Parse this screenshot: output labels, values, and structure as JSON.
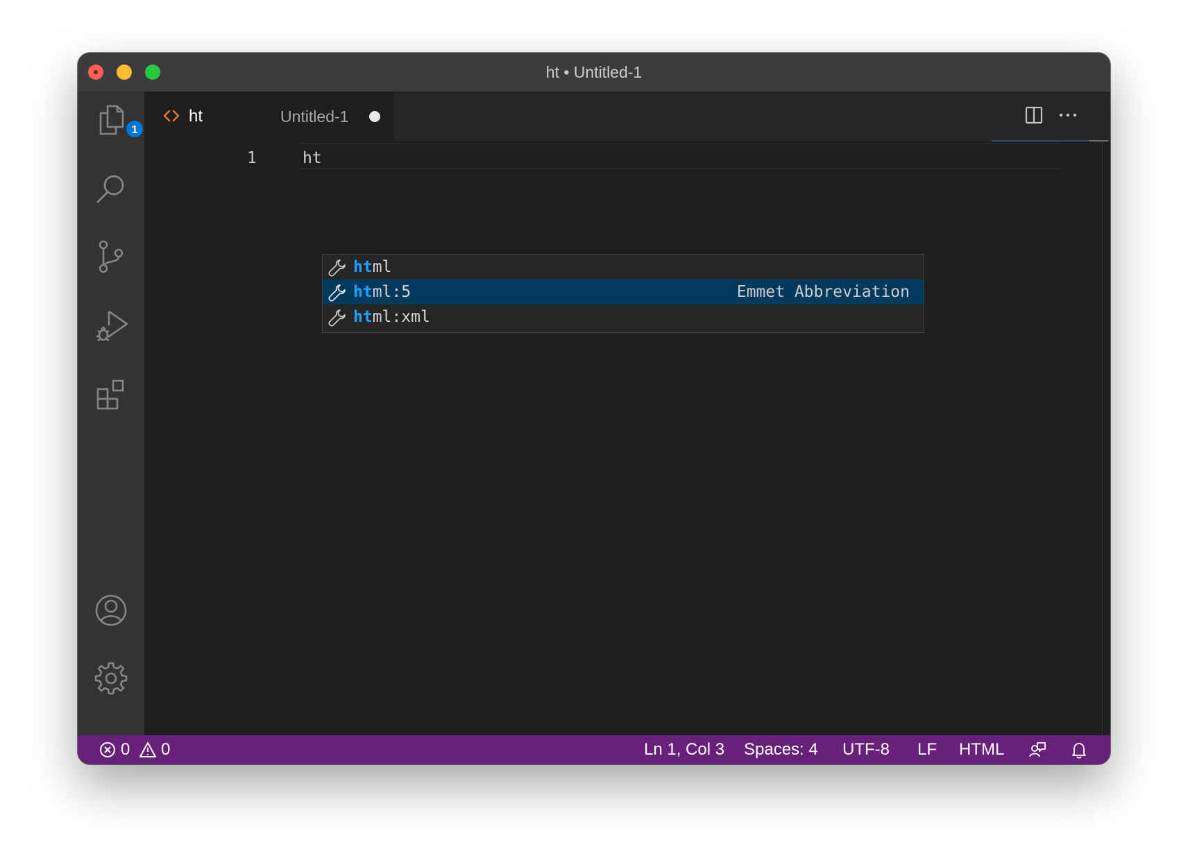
{
  "window": {
    "title": "ht • Untitled-1"
  },
  "activity_bar": {
    "items": [
      {
        "name": "explorer",
        "icon": "files-icon",
        "badge": "1"
      },
      {
        "name": "search",
        "icon": "search-icon"
      },
      {
        "name": "source-control",
        "icon": "source-control-icon"
      },
      {
        "name": "run-and-debug",
        "icon": "run-debug-icon"
      },
      {
        "name": "extensions",
        "icon": "extensions-icon"
      },
      {
        "name": "accounts",
        "icon": "account-icon"
      },
      {
        "name": "manage",
        "icon": "gear-icon"
      }
    ]
  },
  "tab": {
    "name": "ht",
    "description": "Untitled-1",
    "icon": "html-file-icon",
    "dirty": true,
    "icon_color": "#e37933"
  },
  "editor_actions": {
    "split": "split-editor-icon",
    "more": "more-actions-icon"
  },
  "editor": {
    "line_number": "1",
    "line_text": "ht"
  },
  "suggestions": {
    "typed_prefix": "ht",
    "selected_index": 1,
    "items": [
      {
        "match": "ht",
        "rest": "ml",
        "detail": "",
        "icon": "wrench-icon"
      },
      {
        "match": "ht",
        "rest": "ml:5",
        "detail": "Emmet Abbreviation",
        "icon": "wrench-icon"
      },
      {
        "match": "ht",
        "rest": "ml:xml",
        "detail": "",
        "icon": "wrench-icon"
      }
    ]
  },
  "status_bar": {
    "errors": "0",
    "warnings": "0",
    "position": "Ln 1, Col 3",
    "indentation": "Spaces: 4",
    "encoding": "UTF-8",
    "eol": "LF",
    "language": "HTML",
    "background_color": "#68217a"
  }
}
